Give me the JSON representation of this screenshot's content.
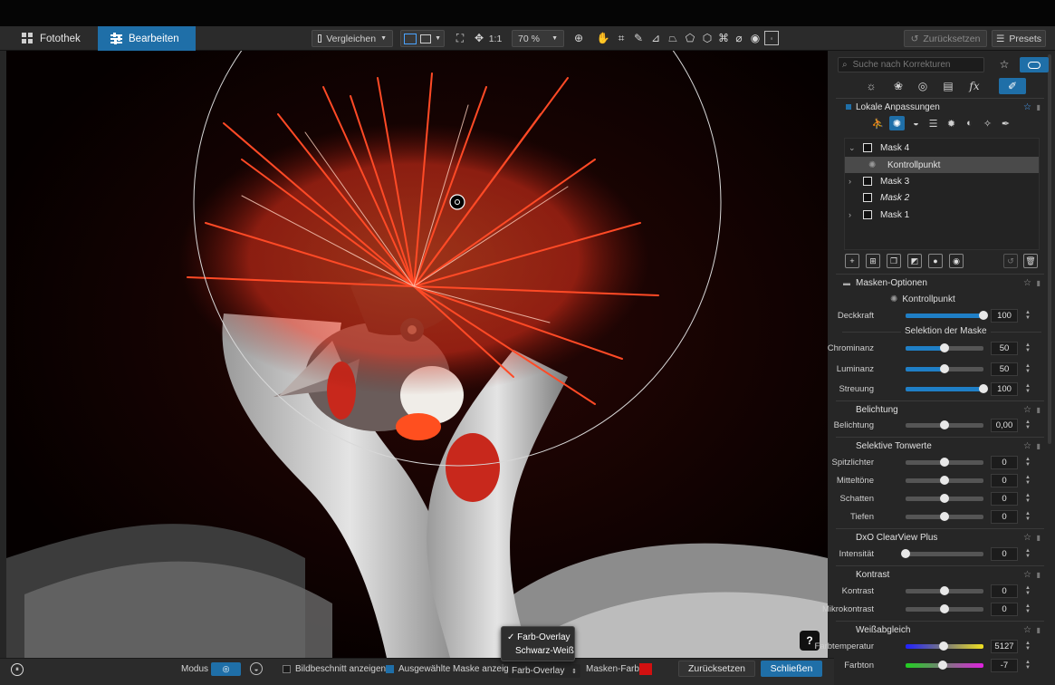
{
  "nav": {
    "tab_library": "Fotothek",
    "tab_edit": "Bearbeiten"
  },
  "toolbar": {
    "compare_label": "Vergleichen",
    "zoom_1to1": "1:1",
    "zoom_value": "70 %",
    "reset_label": "Zurücksetzen",
    "presets_label": "Presets"
  },
  "panel": {
    "search_placeholder": "Suche nach Korrekturen",
    "local_adjustments": "Lokale Anpassungen",
    "masks": [
      {
        "label": "Mask 4",
        "expand": "⌄",
        "italic": false
      },
      {
        "label": "Kontrollpunkt",
        "expand": "",
        "italic": false
      },
      {
        "label": "Mask 3",
        "expand": "›",
        "italic": false
      },
      {
        "label": "Mask 2",
        "expand": "",
        "italic": true
      },
      {
        "label": "Mask 1",
        "expand": "›",
        "italic": false
      }
    ],
    "mask_options": {
      "title": "Masken-Optionen",
      "point_label": "Kontrollpunkt",
      "opacity_label": "Deckkraft",
      "opacity_value": "100",
      "selection_title": "Selektion der Maske",
      "chrominance_label": "Chrominanz",
      "chrominance_value": "50",
      "luminance_label": "Luminanz",
      "luminance_value": "50",
      "spread_label": "Streuung",
      "spread_value": "100"
    },
    "exposure": {
      "title": "Belichtung",
      "label": "Belichtung",
      "value": "0,00"
    },
    "selective_tones": {
      "title": "Selektive Tonwerte",
      "highlights_label": "Spitzlichter",
      "highlights_value": "0",
      "midtones_label": "Mitteltöne",
      "midtones_value": "0",
      "shadows_label": "Schatten",
      "shadows_value": "0",
      "blacks_label": "Tiefen",
      "blacks_value": "0"
    },
    "clearview": {
      "title": "DxO ClearView Plus",
      "intensity_label": "Intensität",
      "intensity_value": "0"
    },
    "contrast": {
      "title": "Kontrast",
      "contrast_label": "Kontrast",
      "contrast_value": "0",
      "micro_label": "Mikrokontrast",
      "micro_value": "0"
    },
    "white_balance": {
      "title": "Weißabgleich",
      "temp_label": "Farbtemperatur",
      "temp_value": "5127",
      "tint_label": "Farbton",
      "tint_value": "-7"
    }
  },
  "bottom": {
    "mode_label": "Modus",
    "crop_label": "Bildbeschnitt anzeigen",
    "mask_label": "Ausgewählte Maske anzeigen",
    "overlay_select": "Farb-Overlay",
    "mask_color_label": "Masken-Farbe",
    "mask_color": "#d21010",
    "reset_label": "Zurücksetzen",
    "close_label": "Schließen"
  },
  "dropdown": {
    "option_1": "✓ Farb-Overlay",
    "option_2": "Schwarz-Weiß"
  },
  "canvas": {
    "help_label": "?"
  },
  "slider_levels": {
    "opacity": 1.0,
    "chrominance": 0.5,
    "luminance": 0.5,
    "spread": 1.0,
    "exposure": 0.5,
    "highlights": 0.5,
    "midtones": 0.5,
    "shadows": 0.5,
    "blacks": 0.5,
    "intensity": 0.0,
    "contrast": 0.5,
    "micro": 0.5,
    "temp": 0.49,
    "tint": 0.48
  },
  "colors": {
    "accent": "#1f6fa8",
    "overlay_red": "#ff3c1e"
  }
}
